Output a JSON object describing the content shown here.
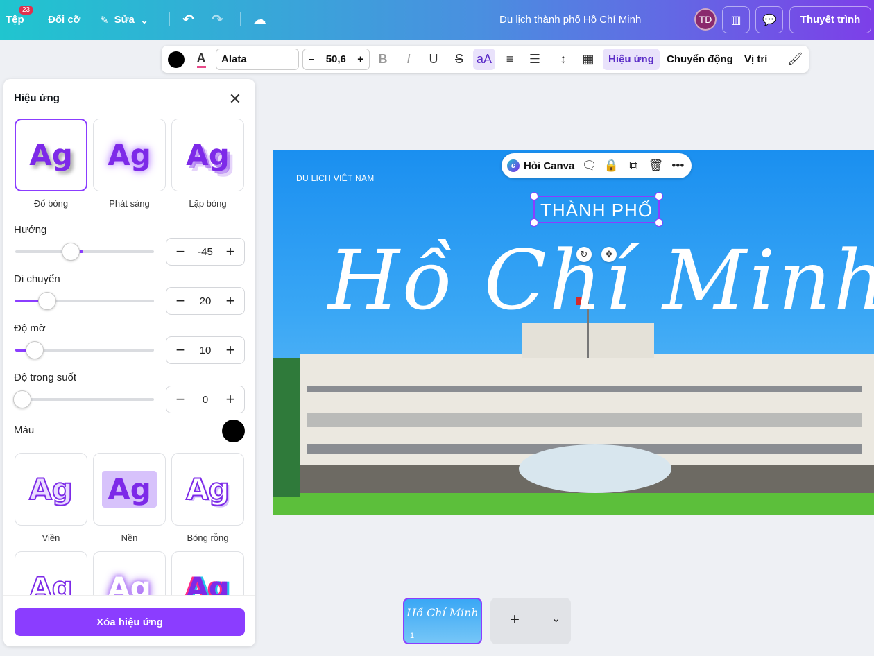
{
  "topbar": {
    "file": "Tệp",
    "badge": "23",
    "resize": "Đổi cỡ",
    "edit": "Sửa",
    "doc_title": "Du lịch thành phố Hồ Chí Minh",
    "avatar": "TD",
    "present": "Thuyết trình"
  },
  "toolbar": {
    "font": "Alata",
    "font_size": "50,6",
    "effects": "Hiệu ứng",
    "animate": "Chuyển động",
    "position": "Vị trí",
    "case": "aA"
  },
  "panel": {
    "title": "Hiệu ứng",
    "styles": [
      {
        "label": "Đổ bóng"
      },
      {
        "label": "Phát sáng"
      },
      {
        "label": "Lặp bóng"
      },
      {
        "label": "Viền"
      },
      {
        "label": "Nền"
      },
      {
        "label": "Bóng rỗng"
      }
    ],
    "sample": "Ag",
    "controls": {
      "direction": {
        "label": "Hướng",
        "value": "-45"
      },
      "offset": {
        "label": "Di chuyển",
        "value": "20"
      },
      "blur": {
        "label": "Độ mờ",
        "value": "10"
      },
      "transparency": {
        "label": "Độ trong suốt",
        "value": "0"
      }
    },
    "color_label": "Màu",
    "shadow_color": "#000000",
    "clear_button": "Xóa hiệu ứng"
  },
  "canvas": {
    "kicker": "DU LỊCH VIỆT NAM",
    "subtitle": "THÀNH PHỐ",
    "title": "Hồ Chí Minh",
    "ask_canva": "Hỏi Canva"
  },
  "pages": {
    "thumb_number": "1"
  },
  "colors": {
    "accent": "#8b3dff",
    "topbar_start": "#20c5cf",
    "topbar_end": "#7d3fe8"
  }
}
